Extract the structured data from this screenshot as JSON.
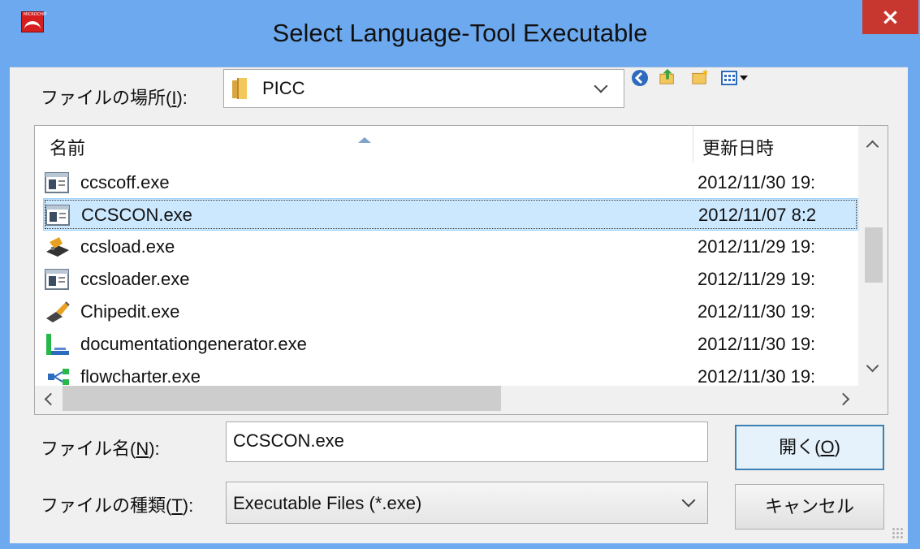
{
  "window": {
    "title": "Select Language-Tool Executable",
    "close_label": "×",
    "app_icon_text": "MICROCHIP"
  },
  "lookin": {
    "label_prefix": "ファイルの場所(",
    "label_key": "I",
    "label_suffix": "):",
    "value": "PICC"
  },
  "toolbar": {
    "icons": [
      "back-icon",
      "up-folder-icon",
      "new-folder-icon",
      "view-menu-icon"
    ]
  },
  "file_list": {
    "columns": {
      "name": "名前",
      "date": "更新日時"
    },
    "rows": [
      {
        "name": "ccscoff.exe",
        "date": "2012/11/30 19:",
        "icon": "console-app-icon",
        "selected": false
      },
      {
        "name": "CCSCON.exe",
        "date": "2012/11/07 8:2",
        "icon": "console-app-icon",
        "selected": true
      },
      {
        "name": "ccsload.exe",
        "date": "2012/11/29 19:",
        "icon": "chip-loader-icon",
        "selected": false
      },
      {
        "name": "ccsloader.exe",
        "date": "2012/11/29 19:",
        "icon": "console-app-icon",
        "selected": false
      },
      {
        "name": "Chipedit.exe",
        "date": "2012/11/30 19:",
        "icon": "chip-edit-icon",
        "selected": false
      },
      {
        "name": "documentationgenerator.exe",
        "date": "2012/11/30 19:",
        "icon": "document-generator-icon",
        "selected": false
      },
      {
        "name": "flowcharter.exe",
        "date": "2012/11/30 19:",
        "icon": "flowchart-icon",
        "selected": false
      }
    ]
  },
  "filename": {
    "label_prefix": "ファイル名(",
    "label_key": "N",
    "label_suffix": "):",
    "value": "CCSCON.exe"
  },
  "filetype": {
    "label_prefix": "ファイルの種類(",
    "label_key": "T",
    "label_suffix": "):",
    "value": "Executable Files (*.exe)"
  },
  "buttons": {
    "open_prefix": "開く(",
    "open_key": "O",
    "open_suffix": ")",
    "cancel": "キャンセル"
  }
}
